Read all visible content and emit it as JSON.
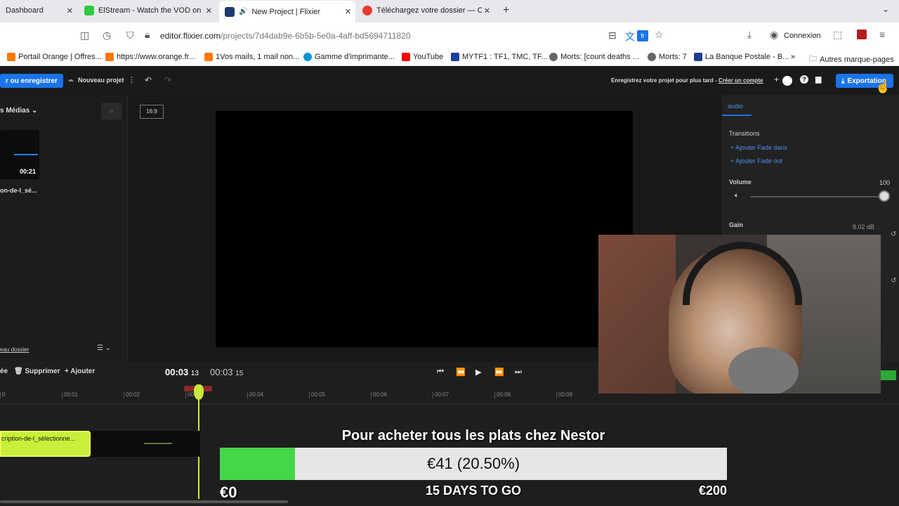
{
  "browser": {
    "tabs": [
      {
        "title": "Dashboard",
        "color": "#ffffff"
      },
      {
        "title": "ElStream - Watch the VOD on K",
        "color": "#2ecc40"
      },
      {
        "title": "New Project | Flixier",
        "color": "#1d3b6e"
      },
      {
        "title": "Téléchargez votre dossier — Co",
        "color": "#e53935"
      }
    ],
    "url_domain": "editor.flixier.com",
    "url_path": "/projects/7d4dab9e-6b5b-5e0a-4aff-bd5694711820",
    "translate_lang": "fr",
    "login_label": "Connexion",
    "bookmarks": [
      {
        "label": "Portail Orange | Offres...",
        "color": "#ff7900"
      },
      {
        "label": "https://www.orange.fr...",
        "color": "#ff7900"
      },
      {
        "label": "1Vos mails, 1 mail non...",
        "color": "#ff7900"
      },
      {
        "label": "Gamme d'imprimante...",
        "color": "#0096d6"
      },
      {
        "label": "YouTube",
        "color": "#ff0000"
      },
      {
        "label": "MYTF1 : TF1, TMC, TF...",
        "color": "#1a3fa0"
      },
      {
        "label": "Morts: [count deaths ...",
        "color": "#666666"
      },
      {
        "label": "Morts: 7",
        "color": "#666666"
      },
      {
        "label": "La Banque Postale - B...",
        "color": "#1f3f8a"
      }
    ],
    "other_bookmarks": "Autres marque-pages"
  },
  "app": {
    "save_button": "r ou enregistrer",
    "project_name": "Nouveau projet",
    "save_hint": "Enregistrez votre projet pour plus tard - ",
    "create_account": "Créer un compte",
    "export_button": "Exportation",
    "aspect_ratio": "16:9",
    "media_header": "s Médias",
    "media_clip_duration": "00:21",
    "media_clip_name": "on-de-l_sé...",
    "new_folder": "eau dossier",
    "right_tab": "audio",
    "transitions_label": "Transitions",
    "fade_in": "Ajouter Fade dans",
    "fade_out": "Ajouter Fade out",
    "volume_label": "Volume",
    "volume_value": "100",
    "gain_label": "Gain",
    "gain_value": "8.02 dB",
    "toolbar_partial": "ée",
    "delete_label": "Supprimer",
    "add_label": "Ajouter",
    "current_time": "00:03",
    "current_frame": "13",
    "total_time": "00:03",
    "total_frame": "15",
    "ruler": [
      "0",
      "00:01",
      "00:02",
      "00:03",
      "00:04",
      "00:05",
      "00:06",
      "00:07",
      "00:08",
      "00:09"
    ],
    "clip_label": "cription-de-l_sélectionne..."
  },
  "donation": {
    "title": "Pour acheter tous les plats chez Nestor",
    "amount_text": "€41 (20.50%)",
    "progress_fraction": 0.205,
    "min_label": "€0",
    "days_label": "15 DAYS TO GO",
    "max_label": "€200",
    "fill_color": "#46d64a"
  }
}
